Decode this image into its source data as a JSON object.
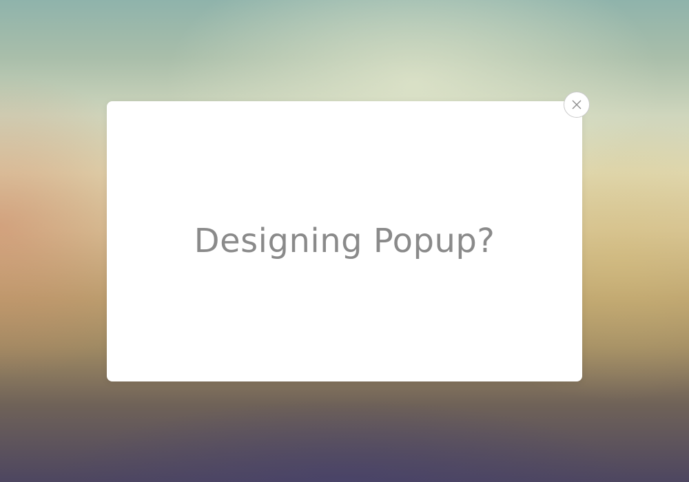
{
  "popup": {
    "title": "Designing Popup?",
    "close_icon": "close-icon"
  },
  "colors": {
    "popup_background": "#ffffff",
    "title_text": "#8a8a8a",
    "close_border": "#c9c9c9"
  }
}
